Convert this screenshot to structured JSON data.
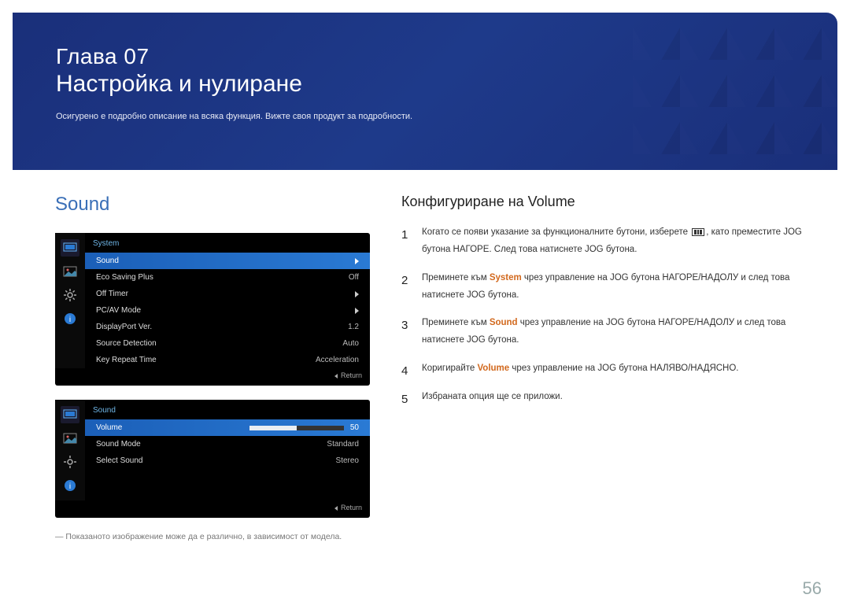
{
  "header": {
    "chapter_prefix": "Глава",
    "chapter_number": "07",
    "title": "Настройка и нулиране",
    "subtitle": "Осигурено е подробно описание на всяка функция. Вижте своя продукт за подробности."
  },
  "left": {
    "section_heading": "Sound",
    "osd1": {
      "title": "System",
      "rows": [
        {
          "label": "Sound",
          "value": "",
          "arrow": true,
          "highlight": true
        },
        {
          "label": "Eco Saving Plus",
          "value": "Off"
        },
        {
          "label": "Off Timer",
          "value": "",
          "arrow": true
        },
        {
          "label": "PC/AV Mode",
          "value": "",
          "arrow": true
        },
        {
          "label": "DisplayPort Ver.",
          "value": "1.2"
        },
        {
          "label": "Source Detection",
          "value": "Auto"
        },
        {
          "label": "Key Repeat Time",
          "value": "Acceleration"
        }
      ],
      "return": "Return"
    },
    "osd2": {
      "title": "Sound",
      "rows": [
        {
          "label": "Volume",
          "value": "50",
          "slider": true,
          "highlight": true
        },
        {
          "label": "Sound Mode",
          "value": "Standard"
        },
        {
          "label": "Select Sound",
          "value": "Stereo"
        }
      ],
      "return": "Return"
    },
    "footnote": "Показаното изображение може да е различно, в зависимост от модела."
  },
  "right": {
    "heading": "Конфигуриране на Volume",
    "steps": {
      "s1_a": "Когато се появи указание за функционалните бутони, изберете ",
      "s1_b": ", като преместите JOG бутона НАГОРЕ. След това натиснете JOG бутона.",
      "s2_a": "Преминете към ",
      "s2_kw": "System",
      "s2_b": " чрез управление на JOG бутона НАГОРЕ/НАДОЛУ и след това натиснете JOG бутона.",
      "s3_a": "Преминете към ",
      "s3_kw": "Sound",
      "s3_b": " чрез управление на JOG бутона НАГОРЕ/НАДОЛУ и след това натиснете JOG бутона.",
      "s4_a": "Коригирайте ",
      "s4_kw": "Volume",
      "s4_b": " чрез управление на JOG бутона НАЛЯВО/НАДЯСНО.",
      "s5": "Избраната опция ще се приложи."
    }
  },
  "page_number": "56",
  "icons": {
    "monitor": "monitor-icon",
    "picture": "picture-icon",
    "gear": "gear-icon",
    "info": "info-icon"
  }
}
